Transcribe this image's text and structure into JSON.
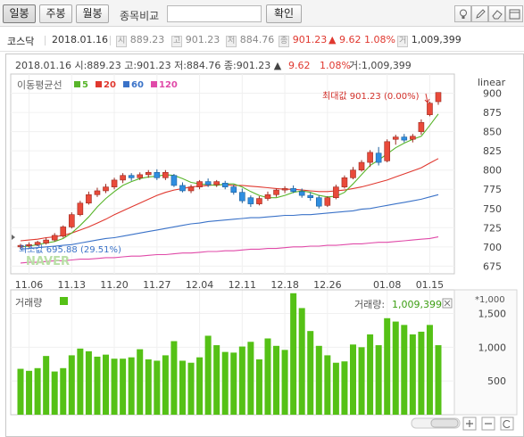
{
  "toolbar": {
    "tabs": [
      "일봉",
      "주봉",
      "월봉"
    ],
    "selected_tab": "일봉",
    "compare_label": "종목비교",
    "compare_placeholder": "",
    "confirm_label": "확인",
    "icons": [
      "lamp-icon",
      "pencil-icon",
      "eraser-icon",
      "cursor-icon",
      "window-icon"
    ]
  },
  "info": {
    "index_name": "코스닥",
    "date": "2018.01.16",
    "open_label": "시",
    "open": "889.23",
    "high_label": "고",
    "high": "901.23",
    "low_label": "저",
    "low": "884.76",
    "close_label": "종",
    "close": "901.23",
    "change": "▲ 9.62",
    "change_pct": "1.08%",
    "volume_label": "거",
    "volume": "1,009,399"
  },
  "chart_header": {
    "text": "2018.01.16 시:889.23 고:901.23 저:884.76 종:901.23 ▲",
    "change": "9.62",
    "change_pct": "1.08%",
    "volume": "거:1,009,399"
  },
  "legend": {
    "title": "이동평균선",
    "items": [
      {
        "label": "5",
        "color": "#58b52a"
      },
      {
        "label": "20",
        "color": "#e0382f"
      },
      {
        "label": "60",
        "color": "#3a72c8"
      },
      {
        "label": "120",
        "color": "#e04aa8"
      }
    ]
  },
  "scale_label": "linear",
  "max_annotation": "최대값 901.23 (0.00%)",
  "min_annotation": "최소값 695.88 (29.51%)",
  "watermark": "NAVER",
  "volume_panel": {
    "title": "거래량",
    "value_label": "거래량:",
    "value": "1,009,399",
    "unit": "*1,000"
  },
  "colors": {
    "up": "#e94a3a",
    "down": "#2f8ee0",
    "ma5": "#58b52a",
    "ma20": "#e0382f",
    "ma60": "#3a72c8",
    "ma120": "#e04aa8",
    "volume": "#55c116"
  },
  "chart_data": [
    {
      "type": "candlestick",
      "x": [
        "11.03",
        "11.06",
        "11.07",
        "11.08",
        "11.09",
        "11.10",
        "11.13",
        "11.14",
        "11.15",
        "11.16",
        "11.17",
        "11.20",
        "11.21",
        "11.22",
        "11.23",
        "11.24",
        "11.27",
        "11.28",
        "11.29",
        "11.30",
        "12.01",
        "12.04",
        "12.05",
        "12.06",
        "12.07",
        "12.08",
        "12.11",
        "12.12",
        "12.13",
        "12.14",
        "12.15",
        "12.18",
        "12.19",
        "12.20",
        "12.21",
        "12.22",
        "12.26",
        "12.27",
        "12.28",
        "01.02",
        "01.03",
        "01.04",
        "01.05",
        "01.08",
        "01.09",
        "01.10",
        "01.11",
        "01.12",
        "01.15",
        "01.16"
      ],
      "x_tick_labels": [
        "11.06",
        "11.13",
        "11.20",
        "11.27",
        "12.04",
        "12.11",
        "12.18",
        "12.26",
        "01.08",
        "01.15"
      ],
      "ylim": [
        665,
        925
      ],
      "y_ticks": [
        675,
        700,
        725,
        750,
        775,
        800,
        825,
        850,
        875,
        900
      ],
      "candles": [
        {
          "o": 700,
          "h": 704,
          "l": 697,
          "c": 702
        },
        {
          "o": 702,
          "h": 706,
          "l": 699,
          "c": 703
        },
        {
          "o": 703,
          "h": 708,
          "l": 701,
          "c": 706
        },
        {
          "o": 705,
          "h": 712,
          "l": 703,
          "c": 709
        },
        {
          "o": 709,
          "h": 718,
          "l": 707,
          "c": 715
        },
        {
          "o": 714,
          "h": 728,
          "l": 712,
          "c": 726
        },
        {
          "o": 726,
          "h": 745,
          "l": 724,
          "c": 742
        },
        {
          "o": 742,
          "h": 760,
          "l": 740,
          "c": 757
        },
        {
          "o": 757,
          "h": 772,
          "l": 755,
          "c": 768
        },
        {
          "o": 768,
          "h": 777,
          "l": 765,
          "c": 773
        },
        {
          "o": 773,
          "h": 782,
          "l": 770,
          "c": 778
        },
        {
          "o": 778,
          "h": 790,
          "l": 775,
          "c": 787
        },
        {
          "o": 787,
          "h": 796,
          "l": 783,
          "c": 793
        },
        {
          "o": 793,
          "h": 796,
          "l": 786,
          "c": 790
        },
        {
          "o": 790,
          "h": 797,
          "l": 787,
          "c": 794
        },
        {
          "o": 794,
          "h": 800,
          "l": 790,
          "c": 797
        },
        {
          "o": 797,
          "h": 801,
          "l": 787,
          "c": 790
        },
        {
          "o": 790,
          "h": 800,
          "l": 787,
          "c": 797
        },
        {
          "o": 793,
          "h": 795,
          "l": 778,
          "c": 780
        },
        {
          "o": 780,
          "h": 784,
          "l": 771,
          "c": 773
        },
        {
          "o": 773,
          "h": 781,
          "l": 770,
          "c": 778
        },
        {
          "o": 778,
          "h": 787,
          "l": 775,
          "c": 785
        },
        {
          "o": 785,
          "h": 789,
          "l": 778,
          "c": 781
        },
        {
          "o": 781,
          "h": 787,
          "l": 778,
          "c": 785
        },
        {
          "o": 783,
          "h": 786,
          "l": 775,
          "c": 778
        },
        {
          "o": 778,
          "h": 781,
          "l": 768,
          "c": 771
        },
        {
          "o": 771,
          "h": 776,
          "l": 757,
          "c": 760
        },
        {
          "o": 764,
          "h": 767,
          "l": 752,
          "c": 756
        },
        {
          "o": 756,
          "h": 766,
          "l": 754,
          "c": 763
        },
        {
          "o": 763,
          "h": 772,
          "l": 760,
          "c": 768
        },
        {
          "o": 768,
          "h": 776,
          "l": 765,
          "c": 774
        },
        {
          "o": 774,
          "h": 779,
          "l": 770,
          "c": 776
        },
        {
          "o": 776,
          "h": 780,
          "l": 770,
          "c": 772
        },
        {
          "o": 772,
          "h": 776,
          "l": 764,
          "c": 767
        },
        {
          "o": 767,
          "h": 771,
          "l": 760,
          "c": 764
        },
        {
          "o": 764,
          "h": 767,
          "l": 750,
          "c": 753
        },
        {
          "o": 754,
          "h": 766,
          "l": 752,
          "c": 764
        },
        {
          "o": 764,
          "h": 781,
          "l": 762,
          "c": 778
        },
        {
          "o": 778,
          "h": 793,
          "l": 776,
          "c": 790
        },
        {
          "o": 790,
          "h": 804,
          "l": 788,
          "c": 800
        },
        {
          "o": 800,
          "h": 813,
          "l": 798,
          "c": 810
        },
        {
          "o": 810,
          "h": 826,
          "l": 804,
          "c": 823
        },
        {
          "o": 822,
          "h": 830,
          "l": 806,
          "c": 810
        },
        {
          "o": 812,
          "h": 840,
          "l": 810,
          "c": 837
        },
        {
          "o": 840,
          "h": 846,
          "l": 833,
          "c": 843
        },
        {
          "o": 843,
          "h": 847,
          "l": 836,
          "c": 839
        },
        {
          "o": 840,
          "h": 847,
          "l": 836,
          "c": 844
        },
        {
          "o": 850,
          "h": 866,
          "l": 846,
          "c": 862
        },
        {
          "o": 872,
          "h": 889,
          "l": 870,
          "c": 887
        },
        {
          "o": 889,
          "h": 901,
          "l": 885,
          "c": 901
        }
      ],
      "ma5": [
        700,
        701,
        703,
        705,
        707,
        711,
        718,
        728,
        739,
        752,
        763,
        772,
        780,
        785,
        789,
        791,
        792,
        794,
        793,
        789,
        784,
        782,
        781,
        780,
        782,
        782,
        778,
        772,
        767,
        764,
        764,
        767,
        771,
        773,
        771,
        767,
        765,
        766,
        771,
        782,
        794,
        806,
        813,
        821,
        829,
        835,
        840,
        844,
        858,
        873
      ],
      "ma20": [
        708,
        709,
        710,
        712,
        713,
        715,
        718,
        722,
        726,
        731,
        736,
        742,
        747,
        752,
        757,
        762,
        767,
        771,
        774,
        776,
        778,
        779,
        780,
        781,
        781,
        780,
        780,
        779,
        778,
        777,
        776,
        775,
        775,
        774,
        773,
        772,
        772,
        773,
        774,
        776,
        778,
        781,
        784,
        787,
        791,
        795,
        799,
        803,
        809,
        815
      ],
      "ma60": [
        697,
        698,
        699,
        700,
        701,
        702,
        703,
        705,
        707,
        709,
        711,
        712,
        714,
        716,
        718,
        720,
        722,
        724,
        726,
        728,
        730,
        731,
        733,
        734,
        735,
        736,
        737,
        738,
        738,
        739,
        740,
        741,
        741,
        742,
        742,
        743,
        744,
        745,
        746,
        747,
        749,
        750,
        752,
        754,
        756,
        758,
        760,
        762,
        765,
        768
      ],
      "ma120": [
        679,
        680,
        680,
        681,
        682,
        682,
        683,
        684,
        684,
        685,
        686,
        686,
        687,
        688,
        688,
        689,
        690,
        690,
        691,
        692,
        692,
        693,
        694,
        694,
        695,
        695,
        696,
        697,
        697,
        698,
        698,
        699,
        700,
        700,
        701,
        701,
        702,
        702,
        703,
        704,
        704,
        705,
        706,
        706,
        707,
        708,
        709,
        710,
        711,
        713
      ]
    },
    {
      "type": "bar",
      "title": "거래량",
      "unit": "*1,000",
      "ylim": [
        0,
        1850
      ],
      "y_ticks": [
        500,
        1000,
        1500
      ],
      "values": [
        680,
        650,
        690,
        870,
        640,
        690,
        880,
        980,
        940,
        860,
        890,
        830,
        830,
        850,
        970,
        820,
        800,
        880,
        1090,
        800,
        770,
        850,
        1170,
        1030,
        930,
        920,
        1010,
        1080,
        820,
        1130,
        1020,
        960,
        1800,
        1580,
        1240,
        1020,
        880,
        770,
        790,
        1040,
        1000,
        1190,
        1030,
        1430,
        1380,
        1330,
        1190,
        1230,
        1330,
        1030
      ]
    }
  ]
}
